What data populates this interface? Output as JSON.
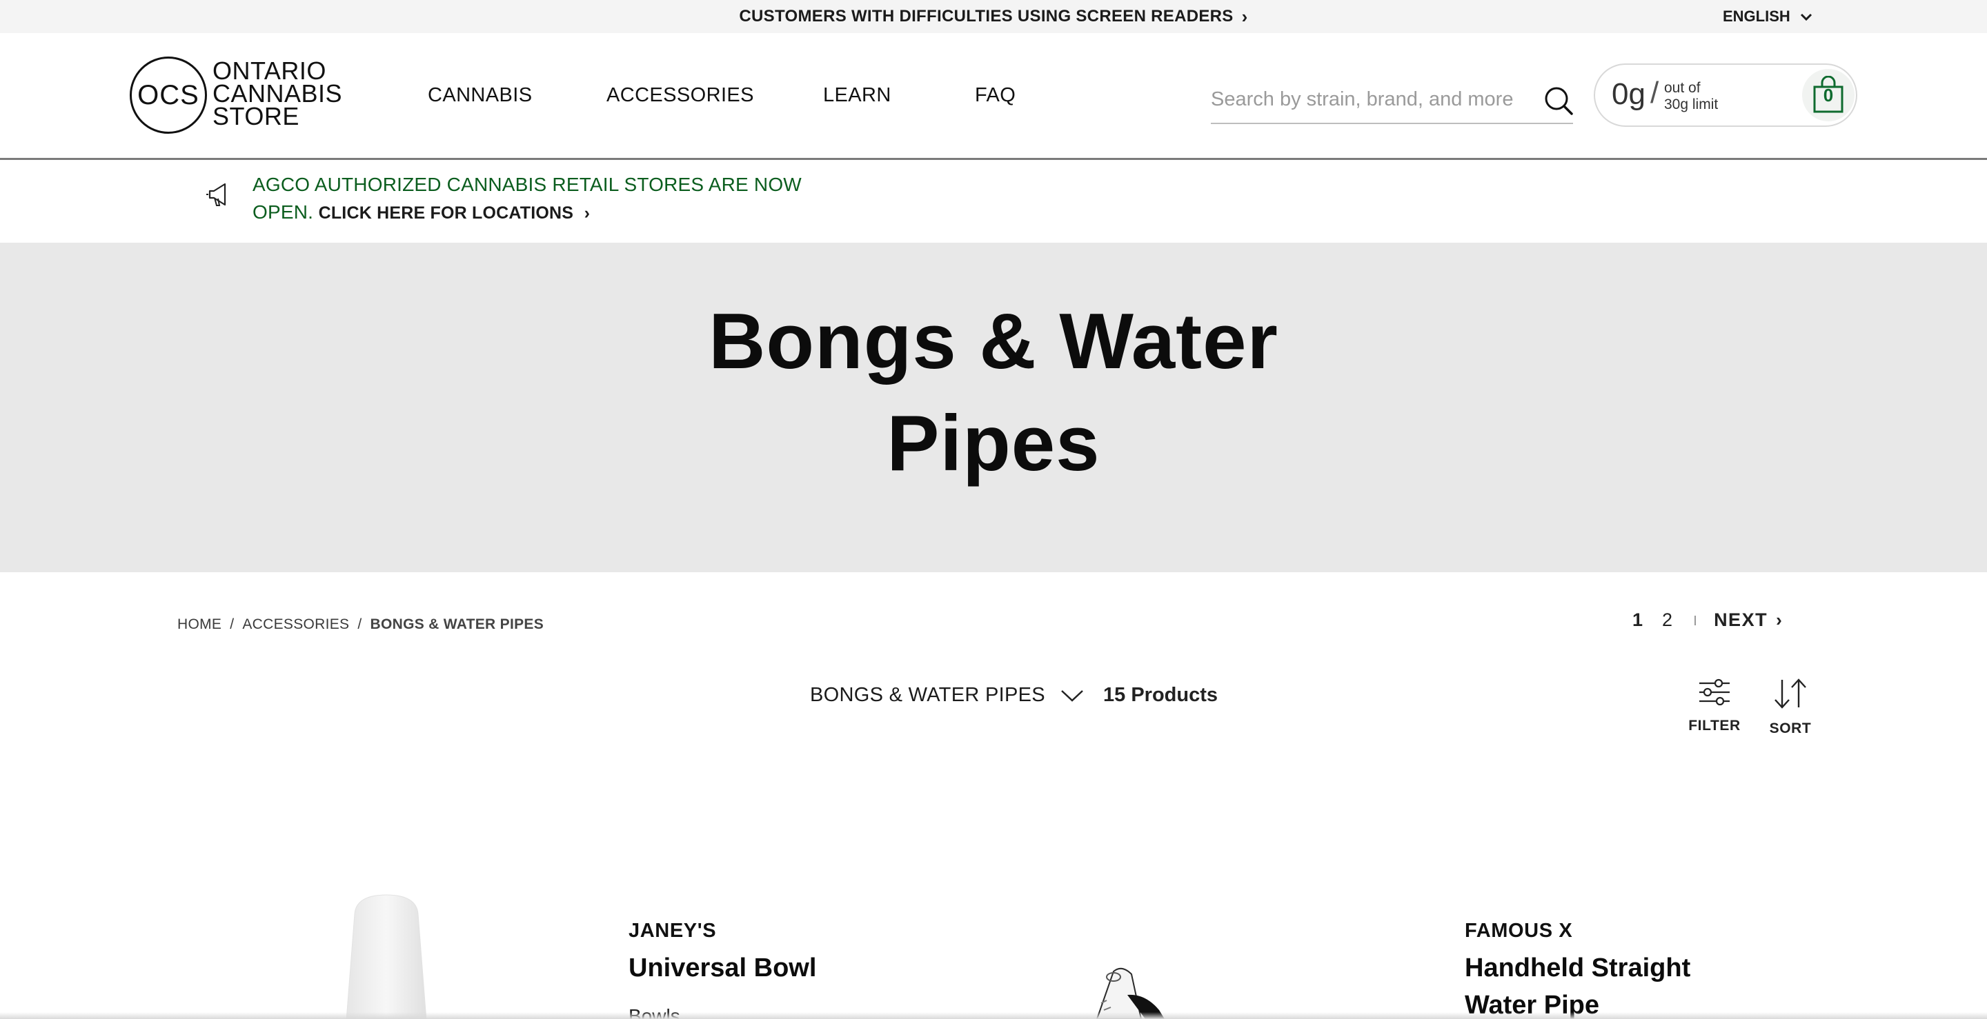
{
  "topbar": {
    "accessibility_link": "CUSTOMERS WITH DIFFICULTIES USING SCREEN READERS",
    "language": "ENGLISH"
  },
  "header": {
    "logo_mark": "OCS",
    "logo_text": [
      "ONTARIO",
      "CANNABIS",
      "STORE"
    ],
    "nav": [
      "CANNABIS",
      "ACCESSORIES",
      "LEARN",
      "FAQ"
    ],
    "search_placeholder": "Search by strain, brand, and more",
    "cart": {
      "grams": "0g",
      "slash": "/",
      "limit_line1": "out of",
      "limit_line2": "30g limit",
      "item_count": "0"
    }
  },
  "announcement": {
    "line1": "AGCO AUTHORIZED CANNABIS RETAIL STORES ARE NOW",
    "line2_green": "OPEN.",
    "line2_link": "CLICK HERE FOR LOCATIONS"
  },
  "hero": {
    "title_line1": "Bongs & Water",
    "title_line2": "Pipes"
  },
  "breadcrumb": [
    "HOME",
    "ACCESSORIES",
    "BONGS & WATER PIPES"
  ],
  "pagination": {
    "pages": [
      "1",
      "2"
    ],
    "current": "1",
    "next_label": "NEXT"
  },
  "listing": {
    "category_select": "BONGS & WATER PIPES",
    "product_count": "15 Products",
    "filter_label": "FILTER",
    "sort_label": "SORT"
  },
  "products": [
    {
      "brand": "JANEY'S",
      "name": "Universal Bowl",
      "type": "Bowls"
    },
    {
      "brand": "FAMOUS X",
      "name_line1": "Handheld Straight",
      "name_line2": "Water Pipe"
    }
  ],
  "colors": {
    "topbar_bg": "#f4f4f4",
    "hero_bg": "#e8e8e8",
    "announcement_green": "#0b5d1e",
    "cart_count_green": "#0f6b2f"
  }
}
